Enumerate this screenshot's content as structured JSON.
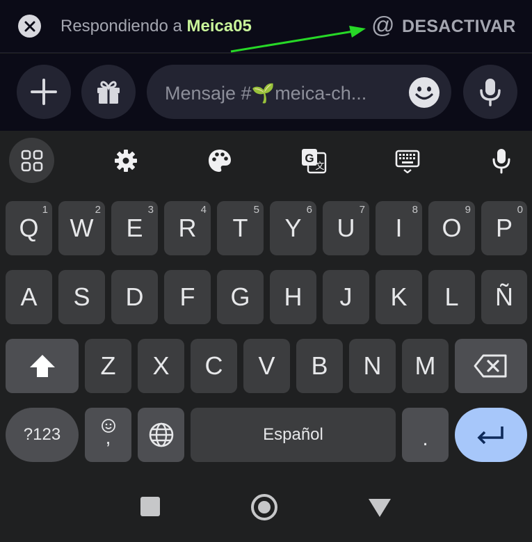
{
  "reply_bar": {
    "prefix": "Respondiendo a ",
    "username": "Meica05",
    "at_symbol": "@",
    "deactivate_label": "DESACTIVAR",
    "arrow_color": "#27d827"
  },
  "composer": {
    "placeholder": "Mensaje #🌱meica-ch..."
  },
  "keyboard": {
    "toolbar_icons": [
      "apps-icon",
      "settings-icon",
      "palette-icon",
      "translate-icon",
      "keyboard-icon",
      "mic-icon"
    ],
    "row1": [
      {
        "label": "Q",
        "hint": "1"
      },
      {
        "label": "W",
        "hint": "2"
      },
      {
        "label": "E",
        "hint": "3"
      },
      {
        "label": "R",
        "hint": "4"
      },
      {
        "label": "T",
        "hint": "5"
      },
      {
        "label": "Y",
        "hint": "6"
      },
      {
        "label": "U",
        "hint": "7"
      },
      {
        "label": "I",
        "hint": "8"
      },
      {
        "label": "O",
        "hint": "9"
      },
      {
        "label": "P",
        "hint": "0"
      }
    ],
    "row2": [
      "A",
      "S",
      "D",
      "F",
      "G",
      "H",
      "J",
      "K",
      "L",
      "Ñ"
    ],
    "row3": [
      "Z",
      "X",
      "C",
      "V",
      "B",
      "N",
      "M"
    ],
    "symbols_label": "?123",
    "comma_label": ",",
    "space_label": "Español",
    "period_label": ".",
    "accent_color": "#a7c7fa"
  },
  "nav_bar": {
    "icons": [
      "recents-icon",
      "home-icon",
      "back-icon"
    ]
  }
}
